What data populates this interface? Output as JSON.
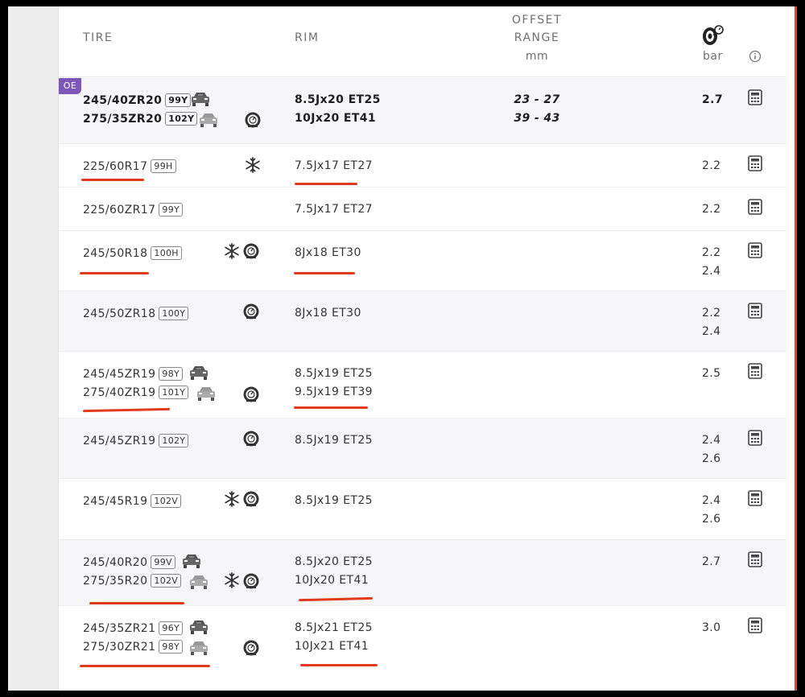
{
  "header": {
    "tire": "TIRE",
    "rim": "RIM",
    "offset_line1": "OFFSET",
    "offset_line2": "RANGE",
    "offset_unit": "mm",
    "pressure_unit": "bar",
    "pressure_icon": "tire-pressure-icon",
    "info_icon": "info-icon"
  },
  "oe_badge": "OE",
  "rows": [
    {
      "tires": [
        [
          "245/40ZR20",
          "99Y"
        ],
        [
          "275/35ZR20",
          "102Y"
        ]
      ],
      "rims": [
        "8.5Jx20 ET25",
        "10Jx20 ET41"
      ],
      "offsets": [
        "23 - 27",
        "39 - 43"
      ],
      "pressures": [
        "2.7"
      ],
      "oe": true
    },
    {
      "tires": [
        [
          "225/60R17",
          "99H"
        ]
      ],
      "rims": [
        "7.5Jx17 ET27"
      ],
      "pressures": [
        "2.2"
      ]
    },
    {
      "tires": [
        [
          "225/60ZR17",
          "99Y"
        ]
      ],
      "rims": [
        "7.5Jx17 ET27"
      ],
      "pressures": [
        "2.2"
      ]
    },
    {
      "tires": [
        [
          "245/50R18",
          "100H"
        ]
      ],
      "rims": [
        "8Jx18 ET30"
      ],
      "pressures": [
        "2.2",
        "2.4"
      ]
    },
    {
      "tires": [
        [
          "245/50ZR18",
          "100Y"
        ]
      ],
      "rims": [
        "8Jx18 ET30"
      ],
      "pressures": [
        "2.2",
        "2.4"
      ]
    },
    {
      "tires": [
        [
          "245/45ZR19",
          "98Y"
        ],
        [
          "275/40ZR19",
          "101Y"
        ]
      ],
      "rims": [
        "8.5Jx19 ET25",
        "9.5Jx19 ET39"
      ],
      "pressures": [
        "2.5"
      ]
    },
    {
      "tires": [
        [
          "245/45ZR19",
          "102Y"
        ]
      ],
      "rims": [
        "8.5Jx19 ET25"
      ],
      "pressures": [
        "2.4",
        "2.6"
      ]
    },
    {
      "tires": [
        [
          "245/45R19",
          "102V"
        ]
      ],
      "rims": [
        "8.5Jx19 ET25"
      ],
      "pressures": [
        "2.4",
        "2.6"
      ]
    },
    {
      "tires": [
        [
          "245/40R20",
          "99V"
        ],
        [
          "275/35R20",
          "102V"
        ]
      ],
      "rims": [
        "8.5Jx20 ET25",
        "10Jx20 ET41"
      ],
      "pressures": [
        "2.7"
      ]
    },
    {
      "tires": [
        [
          "245/35ZR21",
          "96Y"
        ],
        [
          "275/30ZR21",
          "98Y"
        ]
      ],
      "rims": [
        "8.5Jx21 ET25",
        "10Jx21 ET41"
      ],
      "pressures": [
        "3.0"
      ]
    }
  ],
  "icons": {
    "front_axle": "car-front-axle-icon",
    "rear_axle": "car-rear-axle-icon",
    "snowflake": "snowflake-icon",
    "runflat": "runflat-tire-icon",
    "calculator": "calculator-icon"
  },
  "colors": {
    "oe_badge": "#7e56b8",
    "annotation_red": "#e23a1c",
    "shaded_row": "#f6f6f8"
  }
}
